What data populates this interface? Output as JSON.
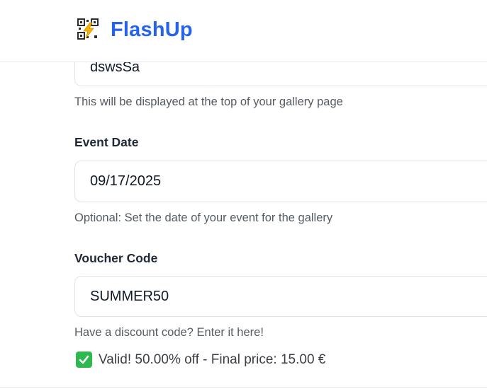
{
  "header": {
    "brand": "FlashUp",
    "logo_icon": "qr-lightning-icon"
  },
  "form": {
    "gallery_title": {
      "value": "dswsSa",
      "helper": "This will be displayed at the top of your gallery page"
    },
    "event_date": {
      "label": "Event Date",
      "value": "09/17/2025",
      "helper": "Optional: Set the date of your event for the gallery"
    },
    "voucher": {
      "label": "Voucher Code",
      "value": "SUMMER50",
      "helper": "Have a discount code? Enter it here!",
      "status_icon": "check-mark-icon",
      "status_text": "Valid! 50.00% off - Final price: 15.00 €",
      "status_color": "#2fb84f"
    }
  }
}
